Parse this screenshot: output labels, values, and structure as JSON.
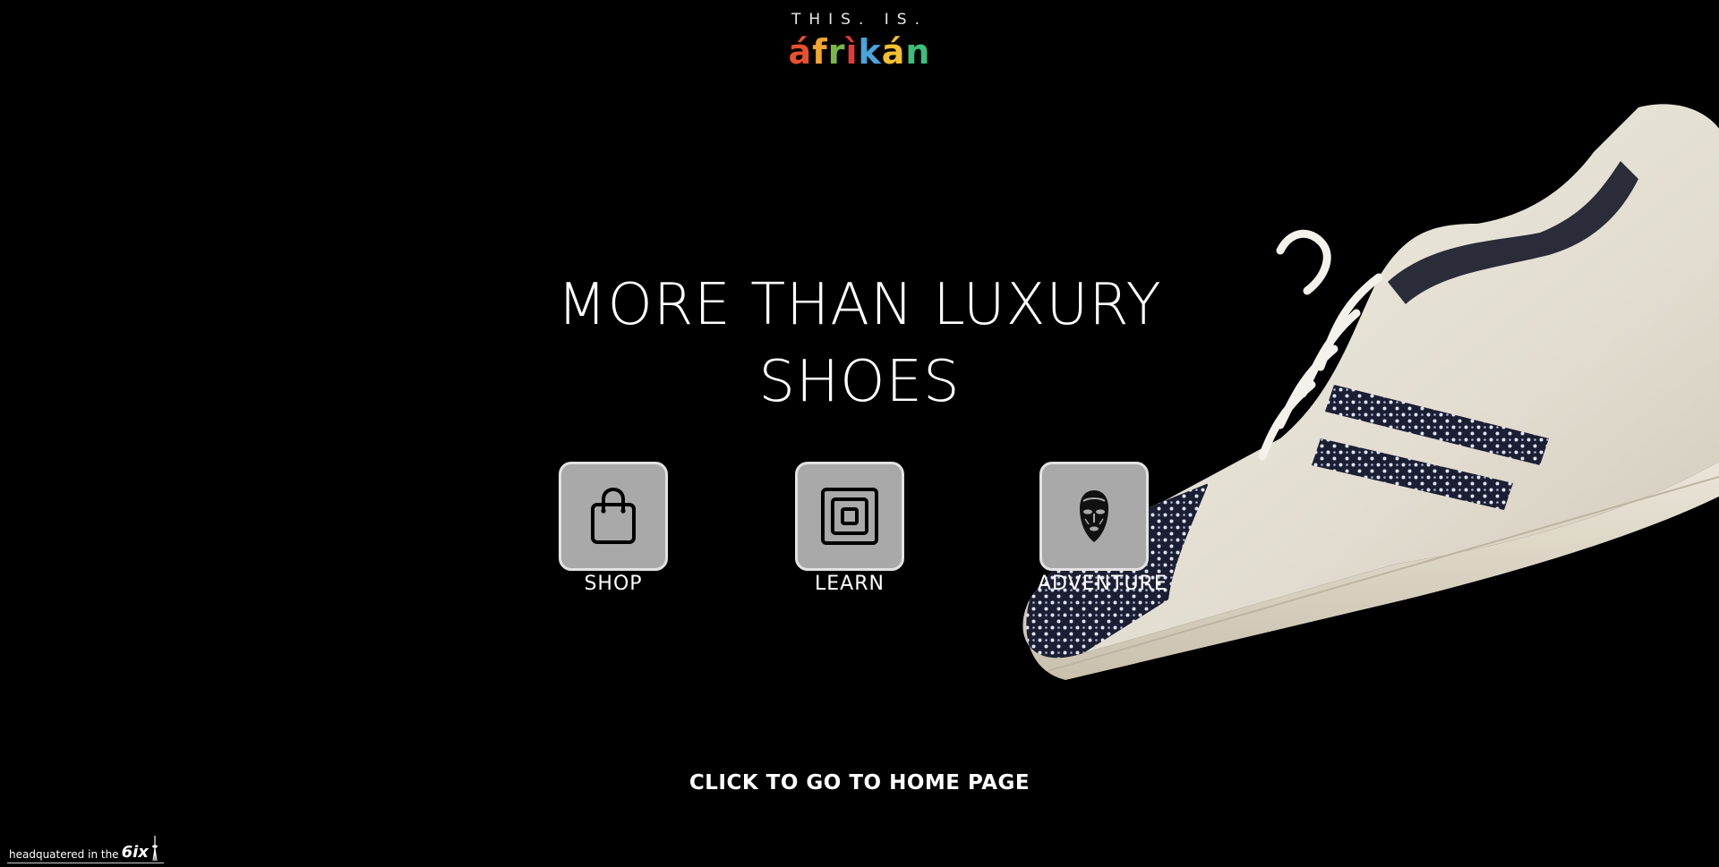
{
  "logo": {
    "tagline": "THIS. IS.",
    "wordmark_letters": [
      "á",
      "f",
      "r",
      "ì",
      "k",
      "á",
      "n"
    ],
    "wordmark_colors": [
      "#e8502f",
      "#f2a531",
      "#7ab648",
      "#e23b3b",
      "#4aa3d9",
      "#f2c12e",
      "#3bbf7a"
    ]
  },
  "hero": {
    "headline_line1": "MORE THAN LUXURY",
    "headline_line2": "SHOES"
  },
  "tiles": [
    {
      "label": "SHOP",
      "icon": "shopping-bag-icon"
    },
    {
      "label": "LEARN",
      "icon": "nested-squares-icon"
    },
    {
      "label": "ADVENTURE",
      "icon": "african-mask-icon"
    }
  ],
  "cta": {
    "label": "CLICK TO GO TO HOME PAGE"
  },
  "footer": {
    "text": "headquatered in the",
    "highlight": "6ix"
  },
  "colors": {
    "background": "#000000",
    "tile_fill": "#a9a9a9",
    "tile_border": "#e2e2e2",
    "text": "#ffffff"
  }
}
